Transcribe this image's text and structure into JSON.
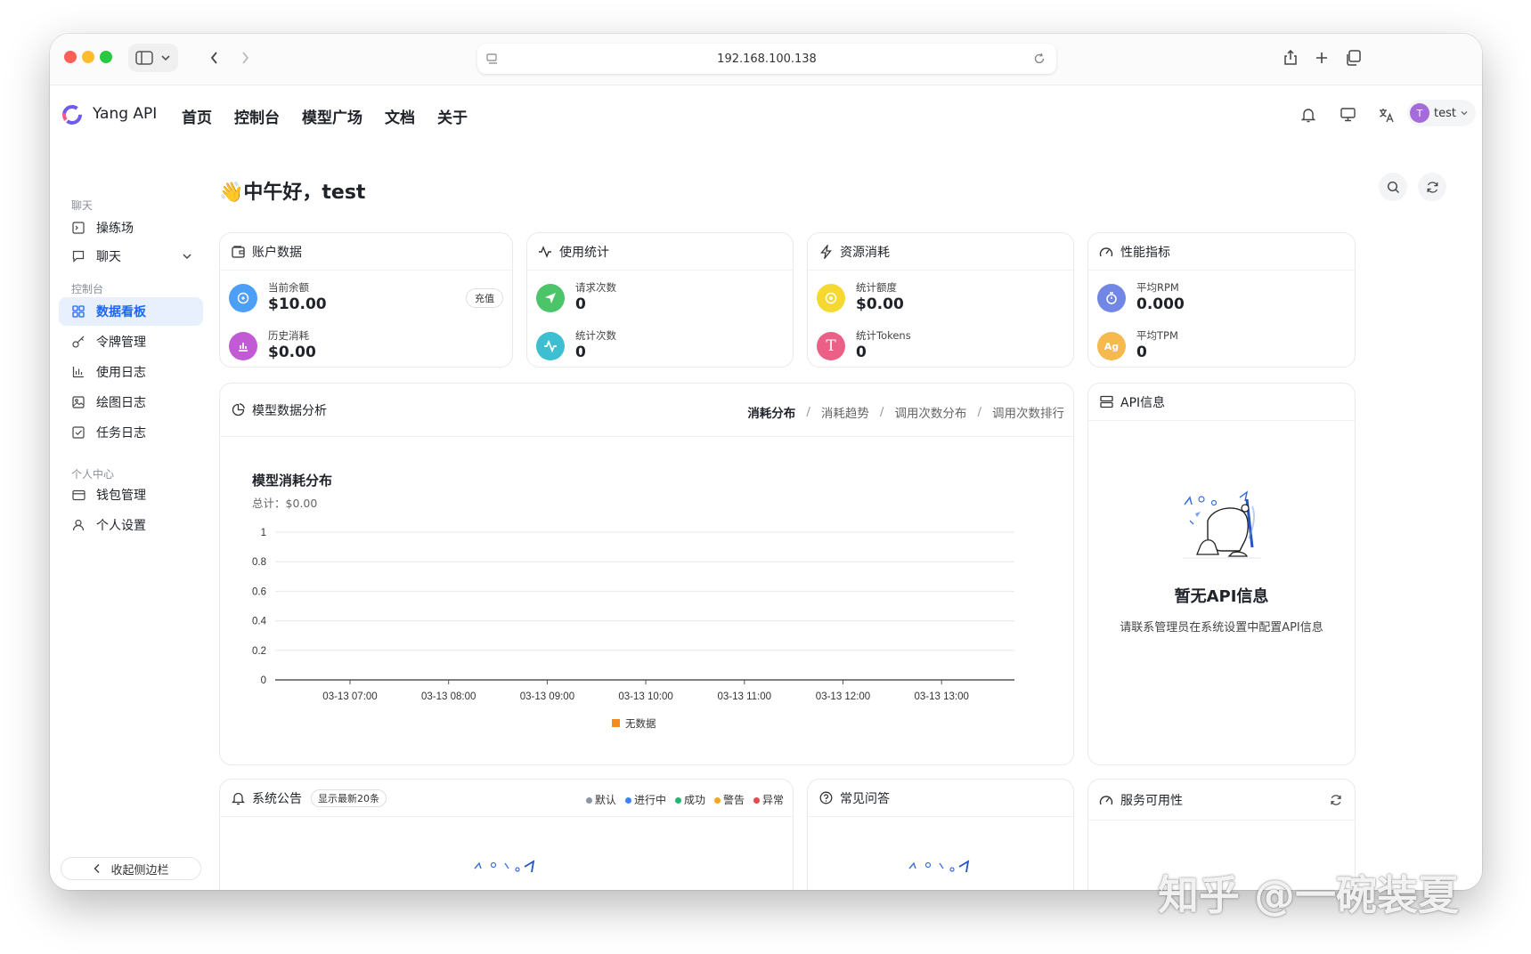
{
  "browser": {
    "url": "192.168.100.138"
  },
  "app": {
    "brand": "Yang API",
    "nav": [
      "首页",
      "控制台",
      "模型广场",
      "文档",
      "关于"
    ],
    "user": {
      "initial": "T",
      "name": "test",
      "avatar_color": "#a56bd9"
    }
  },
  "sidebar": {
    "sections": [
      {
        "label": "聊天",
        "items": [
          {
            "label": "操练场",
            "icon": "terminal-icon"
          },
          {
            "label": "聊天",
            "icon": "chat-icon",
            "expandable": true
          }
        ]
      },
      {
        "label": "控制台",
        "items": [
          {
            "label": "数据看板",
            "icon": "dashboard-icon",
            "active": true
          },
          {
            "label": "令牌管理",
            "icon": "key-icon"
          },
          {
            "label": "使用日志",
            "icon": "bar-chart-icon"
          },
          {
            "label": "绘图日志",
            "icon": "image-icon"
          },
          {
            "label": "任务日志",
            "icon": "checkbox-icon"
          }
        ]
      },
      {
        "label": "个人中心",
        "items": [
          {
            "label": "钱包管理",
            "icon": "wallet-icon"
          },
          {
            "label": "个人设置",
            "icon": "user-icon"
          }
        ]
      }
    ],
    "collapse_label": "收起侧边栏",
    "accent": "#1a66ff"
  },
  "greeting": "👋中午好，test",
  "cards": {
    "account": {
      "title": "账户数据",
      "stats": [
        {
          "label": "当前余额",
          "value": "$10.00",
          "color": "#4d9ef7"
        },
        {
          "label": "历史消耗",
          "value": "$0.00",
          "color": "#c25ad6"
        }
      ],
      "recharge": "充值"
    },
    "usage": {
      "title": "使用统计",
      "stats": [
        {
          "label": "请求次数",
          "value": "0",
          "color": "#4cc46a"
        },
        {
          "label": "统计次数",
          "value": "0",
          "color": "#3ebfd1"
        }
      ]
    },
    "resource": {
      "title": "资源消耗",
      "stats": [
        {
          "label": "统计额度",
          "value": "$0.00",
          "color": "#f5d931"
        },
        {
          "label": "统计Tokens",
          "value": "0",
          "color": "#ec5f86",
          "glyph": "T"
        }
      ]
    },
    "performance": {
      "title": "性能指标",
      "stats": [
        {
          "label": "平均RPM",
          "value": "0.000",
          "color": "#7286e6"
        },
        {
          "label": "平均TPM",
          "value": "0",
          "color": "#f5b94d",
          "glyph": "Ag"
        }
      ]
    }
  },
  "analysis": {
    "title": "模型数据分析",
    "tabs": [
      "消耗分布",
      "消耗趋势",
      "调用次数分布",
      "调用次数排行"
    ],
    "active_tab": 0
  },
  "chart_data": {
    "type": "bar",
    "title": "模型消耗分布",
    "subtitle": "总计：$0.00",
    "categories": [
      "03-13 07:00",
      "03-13 08:00",
      "03-13 09:00",
      "03-13 10:00",
      "03-13 11:00",
      "03-13 12:00",
      "03-13 13:00"
    ],
    "series": [
      {
        "name": "无数据",
        "values": [
          0,
          0,
          0,
          0,
          0,
          0,
          0
        ],
        "color": "#f28c1e"
      }
    ],
    "yticks": [
      "0",
      "0.2",
      "0.4",
      "0.6",
      "0.8",
      "1"
    ],
    "ylim": [
      0,
      1
    ],
    "grid": true,
    "legend": "bottom"
  },
  "api_info": {
    "title": "API信息",
    "empty_title": "暂无API信息",
    "empty_desc": "请联系管理员在系统设置中配置API信息"
  },
  "announcements": {
    "title": "系统公告",
    "badge": "显示最新20条",
    "legend": [
      {
        "label": "默认",
        "color": "#8c95a3"
      },
      {
        "label": "进行中",
        "color": "#3b82f6"
      },
      {
        "label": "成功",
        "color": "#22b573"
      },
      {
        "label": "警告",
        "color": "#f5a524"
      },
      {
        "label": "异常",
        "color": "#e5484d"
      }
    ]
  },
  "faq": {
    "title": "常见问答"
  },
  "availability": {
    "title": "服务可用性"
  },
  "watermark": "知乎 @一碗装夏"
}
